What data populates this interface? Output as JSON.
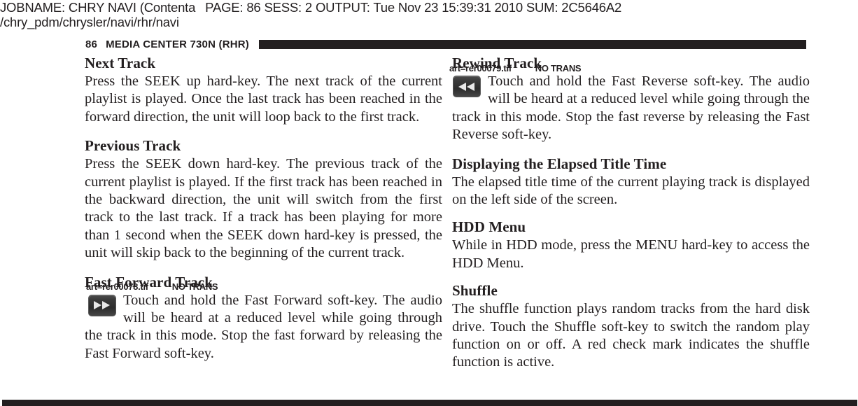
{
  "job_header": {
    "jobname_label": "JOBNAME:",
    "jobname_value": "CHRY NAVI (Contenta",
    "page_label": "PAGE:",
    "page_value": "86",
    "sess_label": "SESS:",
    "sess_value": "2",
    "output_label": "OUTPUT:",
    "output_value": "Tue Nov 23 15:39:31 2010",
    "sum_label": "SUM:",
    "sum_value": "2C5646A2",
    "path": "/chry_pdm/chrysler/navi/rhr/navi"
  },
  "page_title": {
    "number": "86",
    "text": "MEDIA CENTER 730N (RHR)"
  },
  "left_column": {
    "sections": [
      {
        "heading": "Next Track",
        "body": "Press the SEEK up hard-key. The next track of the current playlist is played. Once the last track has been reached in the forward direction, the unit will loop back to the first track."
      },
      {
        "heading": "Previous Track",
        "body": "Press the SEEK down hard-key. The previous track of the current playlist is played. If the first track has been reached in the backward direction, the unit will switch from the first track to the last track. If a track has been playing for more than 1 second when the SEEK down hard-key is pressed, the unit will skip back to the beginning of the current track."
      },
      {
        "heading": "Fast Forward Track",
        "body": "Touch and hold the Fast Forward soft-key. The audio will be heard at a reduced level while going through the track in this mode. Stop the fast forward by releasing the Fast Forward soft-key.",
        "art_file": "art=rer00078.tif",
        "art_note": "NO TRANS",
        "icon": "fast-forward-icon"
      }
    ]
  },
  "right_column": {
    "sections": [
      {
        "heading": "Rewind Track",
        "body": "Touch and hold the Fast Reverse soft-key. The audio will be heard at a reduced level while going through the track in this mode. Stop the fast reverse by releasing the Fast Reverse soft-key.",
        "art_file": "art=rer00079.tif",
        "art_note": "NO TRANS",
        "icon": "rewind-icon"
      },
      {
        "heading": "Displaying the Elapsed Title Time",
        "body": "The elapsed title time of the current playing track is displayed on the left side of the screen."
      },
      {
        "heading": "HDD Menu",
        "body": "While in HDD mode, press the MENU hard-key to access the HDD Menu."
      },
      {
        "heading": "Shuffle",
        "body": "The shuffle function plays random tracks from the hard disk drive. Touch the Shuffle soft-key to switch the random play function on or off. A red check mark indicates the shuffle function is active."
      }
    ]
  },
  "colors": {
    "ink": "#231f20",
    "paper": "#ffffff",
    "key_face": "#3a3a3a"
  }
}
